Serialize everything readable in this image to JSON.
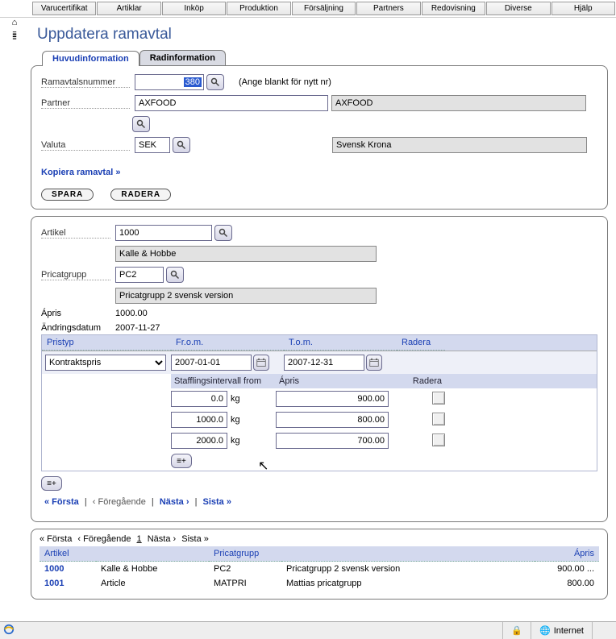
{
  "menubar": [
    "Varucertifikat",
    "Artiklar",
    "Inköp",
    "Produktion",
    "Försäljning",
    "Partners",
    "Redovisning",
    "Diverse",
    "Hjälp"
  ],
  "page_title": "Uppdatera ramavtal",
  "tabs": [
    {
      "label": "Huvudinformation",
      "active": true
    },
    {
      "label": "Radinformation",
      "active": false
    }
  ],
  "head": {
    "ramavtal_label": "Ramavtalsnummer",
    "ramavtal_value": "380",
    "ramavtal_hint": "(Ange blankt för nytt nr)",
    "partner_label": "Partner",
    "partner_value": "AXFOOD",
    "partner_name": "AXFOOD",
    "valuta_label": "Valuta",
    "valuta_value": "SEK",
    "valuta_name": "Svensk Krona",
    "copy_link": "Kopiera ramavtal »",
    "save_label": "SPARA",
    "delete_label": "RADERA"
  },
  "rad": {
    "artikel_label": "Artikel",
    "artikel_value": "1000",
    "artikel_name": "Kalle & Hobbe",
    "pricat_label": "Pricatgrupp",
    "pricat_value": "PC2",
    "pricat_name": "Pricatgrupp 2 svensk version",
    "apris_label": "Ápris",
    "apris_value": "1000.00",
    "andrdatum_label": "Ändringsdatum",
    "andrdatum_value": "2007-11-27",
    "grid_headers": {
      "pristyp": "Pristyp",
      "from": "Fr.o.m.",
      "tom": "T.o.m.",
      "radera": "Radera"
    },
    "pristyp_value": "Kontraktspris",
    "from_value": "2007-01-01",
    "tom_value": "2007-12-31",
    "staff_headers": {
      "from": "Stafflingsintervall from",
      "apris": "Ápris",
      "radera": "Radera"
    },
    "staff_rows": [
      {
        "qty": "0.0",
        "unit": "kg",
        "price": "900.00"
      },
      {
        "qty": "1000.0",
        "unit": "kg",
        "price": "800.00"
      },
      {
        "qty": "2000.0",
        "unit": "kg",
        "price": "700.00"
      }
    ]
  },
  "pager": {
    "first": "« Första",
    "prev": "‹ Föregående",
    "next": "Nästa ›",
    "last": "Sista »"
  },
  "pager2": {
    "first": "« Första",
    "prev": "‹ Föregående",
    "page": "1",
    "next": "Nästa ›",
    "last": "Sista »"
  },
  "listing": {
    "headers": {
      "artikel": "Artikel",
      "pricat": "Pricatgrupp",
      "apris": "Ápris"
    },
    "rows": [
      {
        "artno": "1000",
        "artname": "Kalle & Hobbe",
        "pc": "PC2",
        "pcname": "Pricatgrupp 2 svensk version",
        "price": "900.00 ..."
      },
      {
        "artno": "1001",
        "artname": "Article",
        "pc": "MATPRI",
        "pcname": "Mattias pricatgrupp",
        "price": "800.00"
      }
    ]
  },
  "status": {
    "zone": "Internet"
  }
}
